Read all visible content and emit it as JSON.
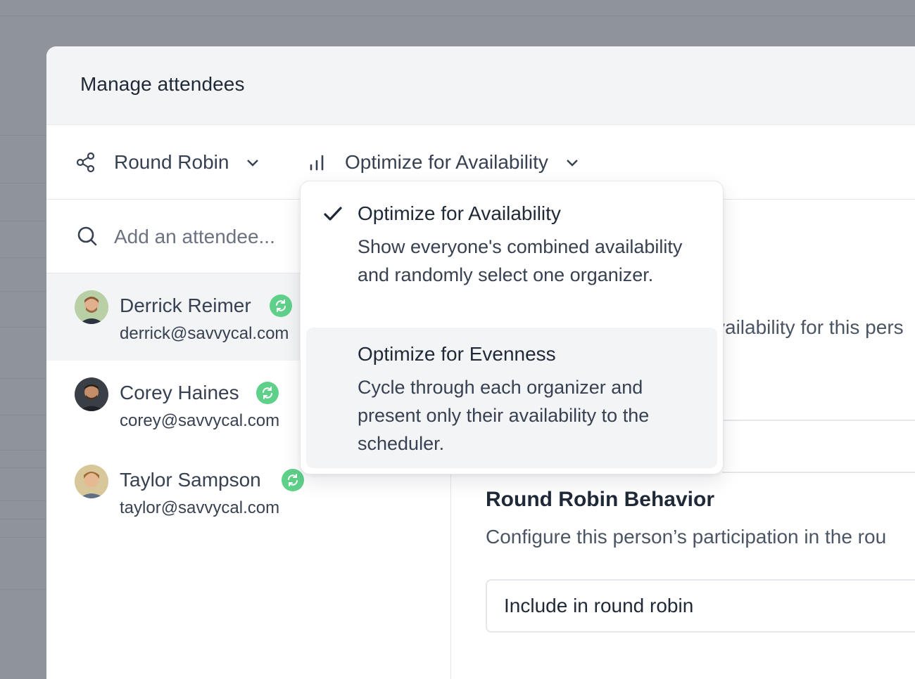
{
  "modal": {
    "title": "Manage attendees"
  },
  "toolbar": {
    "scheduling_mode": {
      "label": "Round Robin",
      "icon": "share-icon"
    },
    "strategy": {
      "label": "Optimize for Availability",
      "icon": "bar-chart-icon"
    }
  },
  "search": {
    "placeholder": "Add an attendee..."
  },
  "attendees": [
    {
      "name": "Derrick Reimer",
      "email": "derrick@savvycal.com",
      "synced": true,
      "selected": true
    },
    {
      "name": "Corey Haines",
      "email": "corey@savvycal.com",
      "synced": true,
      "selected": false
    },
    {
      "name": "Taylor Sampson",
      "email": "taylor@savvycal.com",
      "synced": true,
      "selected": false
    }
  ],
  "strategy_menu": {
    "options": [
      {
        "title": "Optimize for Availability",
        "description": "Show everyone's combined availability and randomly select one organizer.",
        "checked": true
      },
      {
        "title": "Optimize for Evenness",
        "description": "Cycle through each organizer and present only their availability to the scheduler.",
        "checked": false
      }
    ]
  },
  "detail": {
    "availability_partial": "vailability for this pers",
    "round_robin": {
      "title": "Round Robin Behavior",
      "description": "Configure this person’s participation in the rou",
      "select_value": "Include in round robin"
    }
  },
  "colors": {
    "backdrop": "#8f939c",
    "sync_badge": "#5ed08a",
    "header_bg": "#f3f4f6",
    "selected_row": "#f3f4f6"
  }
}
